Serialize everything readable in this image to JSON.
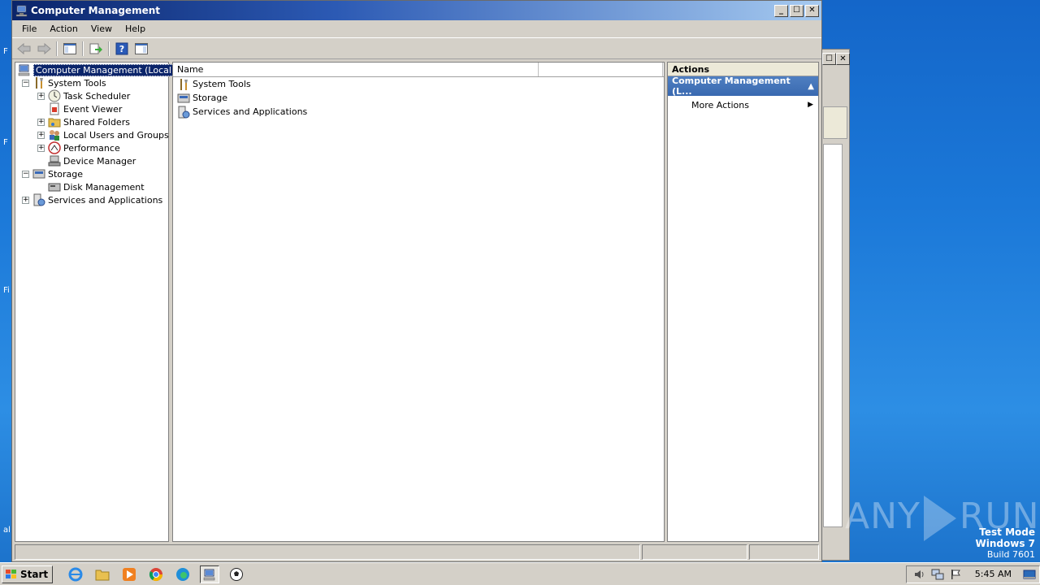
{
  "desktop": {
    "edge_letters": [
      "F",
      "F",
      "Fi",
      "al"
    ]
  },
  "window": {
    "title": "Computer Management",
    "menu": [
      "File",
      "Action",
      "View",
      "Help"
    ]
  },
  "tree": {
    "root": "Computer Management (Local)",
    "items": [
      {
        "label": "System Tools",
        "expander": "−"
      },
      {
        "label": "Task Scheduler",
        "expander": "+"
      },
      {
        "label": "Event Viewer",
        "expander": ""
      },
      {
        "label": "Shared Folders",
        "expander": "+"
      },
      {
        "label": "Local Users and Groups",
        "expander": "+"
      },
      {
        "label": "Performance",
        "expander": "+"
      },
      {
        "label": "Device Manager",
        "expander": ""
      },
      {
        "label": "Storage",
        "expander": "−"
      },
      {
        "label": "Disk Management",
        "expander": ""
      },
      {
        "label": "Services and Applications",
        "expander": "+"
      }
    ]
  },
  "list": {
    "column_name": "Name",
    "rows": [
      "System Tools",
      "Storage",
      "Services and Applications"
    ]
  },
  "actions": {
    "header": "Actions",
    "group": "Computer Management (L...",
    "items": [
      "More Actions"
    ]
  },
  "taskbar": {
    "start_label": "Start",
    "clock": "5:45 AM"
  },
  "watermark": {
    "left": "ANY",
    "right": "RUN"
  },
  "test_mode": {
    "line1": "Test Mode",
    "line2": "Windows 7",
    "line3": "Build 7601"
  },
  "colors": {
    "title_active": "#0a246a",
    "selection": "#0a246a",
    "actions_group": "#3969b0",
    "chrome": "#d4d0c8"
  }
}
